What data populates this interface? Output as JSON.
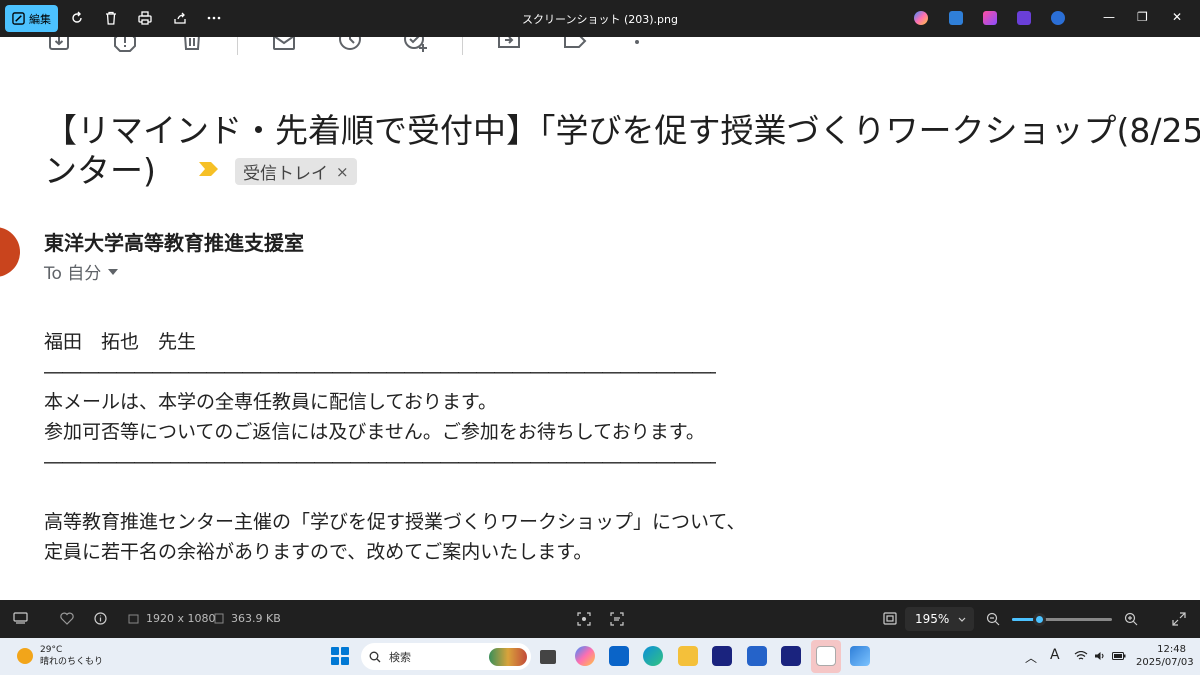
{
  "titlebar": {
    "edit_label": "編集",
    "file_name": "スクリーンショット (203).png",
    "icons": [
      "rotate-icon",
      "delete-icon",
      "print-icon",
      "share-icon",
      "more-icon"
    ],
    "app_icons": [
      "copilot-icon",
      "designer-icon",
      "clipchamp-icon",
      "video-icon",
      "onedrive-icon"
    ],
    "colors": {
      "background": "#202020",
      "accent": "#4cc2ff"
    }
  },
  "email": {
    "subject_line1": "【リマインド・先着順で受付中】「学びを促す授業づくりワークショップ(8/25",
    "subject_line2": "ンター)",
    "label": "受信トレイ",
    "label_close": "×",
    "sender": "東洋大学高等教育推進支援室",
    "to": "To 自分",
    "avatar_color": "#c9441d",
    "body_lines": [
      "福田　拓也　先生",
      "――――――――――――――――――――――――――――――――――――――――――――――――――――――――――",
      "本メールは、本学の全専任教員に配信しております。",
      "参加可否等についてのご返信には及びません。ご参加をお待ちしております。",
      "――――――――――――――――――――――――――――――――――――――――――――――――――――――――――",
      "",
      "高等教育推進センター主催の「学びを促す授業づくりワークショップ」について、",
      "定員に若干名の余裕がありますので、改めてご案内いたします。"
    ]
  },
  "viewer": {
    "dimensions": "1920 x 1080",
    "file_size": "363.9 KB",
    "zoom": "195%",
    "zoom_level": 0.27
  },
  "taskbar": {
    "temperature": "29°C",
    "weather": "晴れのちくもり",
    "search_placeholder": "検索",
    "ime": "A",
    "time": "12:48",
    "date": "2025/07/03"
  }
}
